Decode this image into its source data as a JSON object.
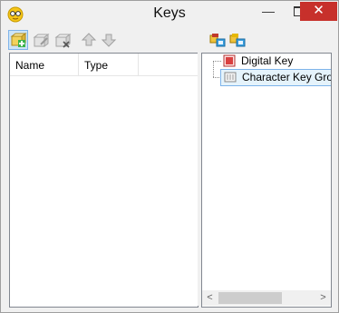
{
  "window": {
    "title": "Keys",
    "minimize_glyph": "—",
    "close_glyph": "✕"
  },
  "toolbar_left": {
    "icons": [
      "add-key-icon",
      "edit-key-icon",
      "delete-key-icon",
      "move-up-icon",
      "move-down-icon"
    ]
  },
  "toolbar_right": {
    "icons": [
      "add-digital-key-icon",
      "add-character-key-group-icon"
    ]
  },
  "keys_list": {
    "columns": [
      "Name",
      "Type"
    ]
  },
  "tree": {
    "items": [
      {
        "label": "Digital Key",
        "icon": "digital-key-icon"
      },
      {
        "label": "Character Key Group",
        "icon": "character-key-group-icon"
      }
    ]
  },
  "scrollbar": {
    "left_glyph": "<",
    "right_glyph": ">"
  },
  "colors": {
    "close": "#c7302b",
    "selection": "#e5f3fb",
    "selection_border": "#7eb4ea"
  }
}
